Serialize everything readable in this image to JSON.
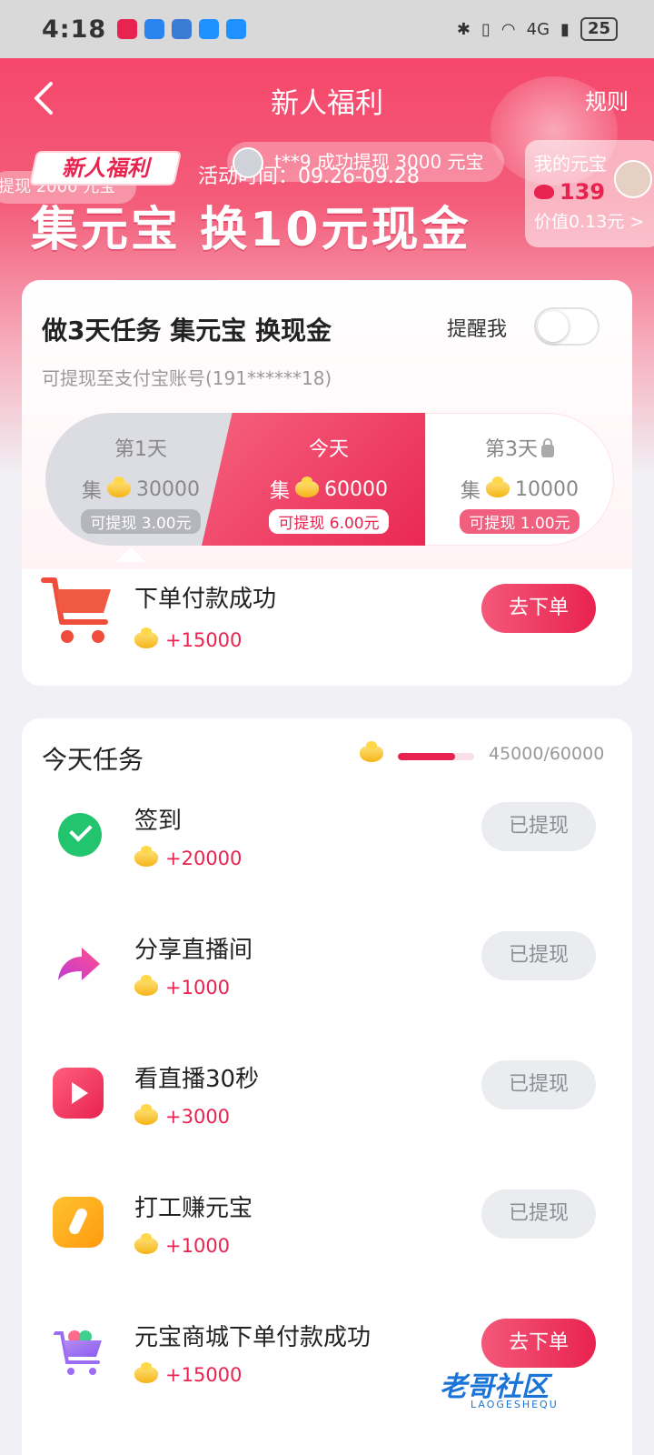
{
  "status_bar": {
    "time": "4:18",
    "network": "4G",
    "battery": "25"
  },
  "nav": {
    "title": "新人福利",
    "rules": "规则"
  },
  "hero": {
    "tag": "新人福利",
    "prev_ticker": "提现 2000 元宝",
    "activity_time": "活动时间：09.26-09.28",
    "ticker": "t**9 成功提现 3000 元宝",
    "headline": "集元宝 换10元现金",
    "my_coins": {
      "label": "我的元宝",
      "value": "139",
      "worth": "价值0.13元 >"
    }
  },
  "card1": {
    "title": "做3天任务 集元宝 换现金",
    "remind_label": "提醒我",
    "subtitle": "可提现至支付宝账号(191******18)",
    "days": [
      {
        "name": "第1天",
        "collect_label": "集",
        "coins": "30000",
        "badge": "可提现 3.00元"
      },
      {
        "name": "今天",
        "collect_label": "集",
        "coins": "60000",
        "badge": "可提现 6.00元"
      },
      {
        "name": "第3天",
        "collect_label": "集",
        "coins": "10000",
        "badge": "可提现 1.00元"
      }
    ],
    "order_task": {
      "title": "下单付款成功",
      "reward": "+15000",
      "button": "去下单"
    }
  },
  "today": {
    "title": "今天任务",
    "progress_text": "45000/60000",
    "progress_fraction": 0.75,
    "tasks": [
      {
        "title": "签到",
        "reward": "+20000",
        "button": "已提现",
        "icon": "check-icon"
      },
      {
        "title": "分享直播间",
        "reward": "+1000",
        "button": "已提现",
        "icon": "share-arrow-icon"
      },
      {
        "title": "看直播30秒",
        "reward": "+3000",
        "button": "已提现",
        "icon": "play-icon"
      },
      {
        "title": "打工赚元宝",
        "reward": "+1000",
        "button": "已提现",
        "icon": "shovel-icon"
      },
      {
        "title": "元宝商城下单付款成功",
        "reward": "+15000",
        "button": "去下单",
        "icon": "shopping-cart-icon"
      }
    ]
  },
  "watermark": {
    "text": "老哥社区",
    "sub": "LAOGESHEQU"
  },
  "colors": {
    "accent": "#e8234f",
    "success": "#22c46e"
  }
}
